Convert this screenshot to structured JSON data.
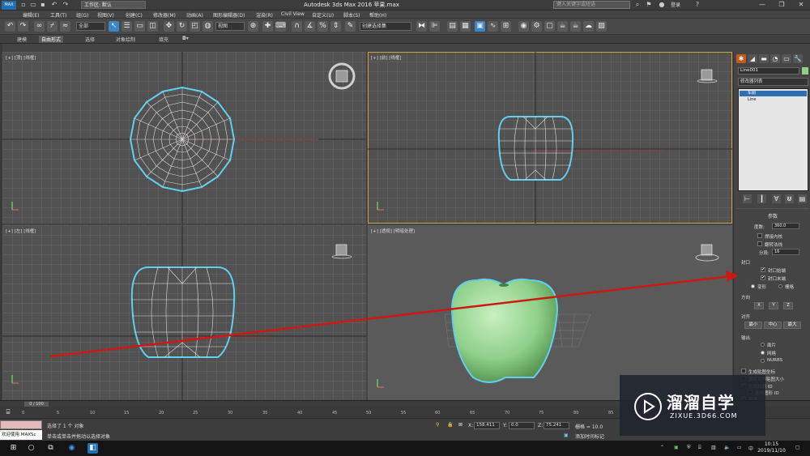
{
  "titlebar": {
    "workspace": "工作区: 默认",
    "window_title": "Autodesk 3ds Max 2016    苹果.max",
    "search_placeholder": "键入关键字或短语",
    "login": "登录"
  },
  "menu": [
    "编辑(E)",
    "工具(T)",
    "组(G)",
    "视图(V)",
    "创建(C)",
    "修改器(M)",
    "动画(A)",
    "图形编辑器(D)",
    "渲染(R)",
    "Civil View",
    "自定义(U)",
    "脚本(S)",
    "帮助(H)"
  ],
  "toolbar": {
    "filter": "全部",
    "refcoord": "视图",
    "selset": "创建选择集"
  },
  "ribbon_tabs": [
    "建模",
    "自由形式",
    "选择",
    "对象绘制",
    "填充"
  ],
  "viewports": {
    "top": "[+] [顶] [线框]",
    "front": "[+] [前] [线框]",
    "left": "[+] [左] [线框]",
    "persp": "[+] [透视] [明暗处理]"
  },
  "command_panel": {
    "object_name": "Line001",
    "modifier_list": "修改器列表",
    "stack": [
      "车削",
      "Line"
    ],
    "params_title": "参数",
    "degrees_label": "度数:",
    "degrees_value": "360.0",
    "weld_core": "焊接内核",
    "flip_normals": "翻转法线",
    "segments_label": "分段:",
    "segments_value": "16",
    "capping": "封口",
    "cap_start": "封口始端",
    "cap_end": "封口末端",
    "morph": "变形",
    "grid": "栅格",
    "direction": "方向",
    "dir_x": "X",
    "dir_y": "Y",
    "dir_z": "Z",
    "align": "对齐",
    "align_min": "最小",
    "align_center": "中心",
    "align_max": "最大",
    "output": "输出",
    "patch": "面片",
    "mesh": "网格",
    "nurbs": "NURBS",
    "gen_map": "生成贴图坐标",
    "real_world": "真实世界贴图大小",
    "gen_mat": "生成材质 ID",
    "use_shape_ids": "使用图形 ID",
    "smooth": "平滑"
  },
  "timeline": {
    "frame": "0 / 100",
    "ticks": [
      "0",
      "5",
      "10",
      "15",
      "20",
      "25",
      "30",
      "35",
      "40",
      "45",
      "50",
      "55",
      "60",
      "65",
      "70",
      "75",
      "80",
      "85",
      "90",
      "95",
      "100"
    ]
  },
  "status": {
    "welcome": "欢迎使用 MAXSc",
    "selected": "选择了 1 个 对象",
    "hint": "单击或单击并拖动以选择对象",
    "x_label": "X:",
    "x_value": "158.411",
    "y_label": "Y:",
    "y_value": "0.0",
    "z_label": "Z:",
    "z_value": "75.241",
    "grid": "栅格 = 10.0",
    "add_time": "添加时间标记"
  },
  "watermark": {
    "main": "溜溜自学",
    "sub": "ZIXUE.3D66.COM"
  },
  "taskbar": {
    "time": "10:15",
    "date": "2019/11/10",
    "lang": "中"
  },
  "colors": {
    "annotation_arrow": "#cc1a12",
    "selection_outline": "#5fd0f0",
    "apple_fill": "#8fd08a"
  }
}
